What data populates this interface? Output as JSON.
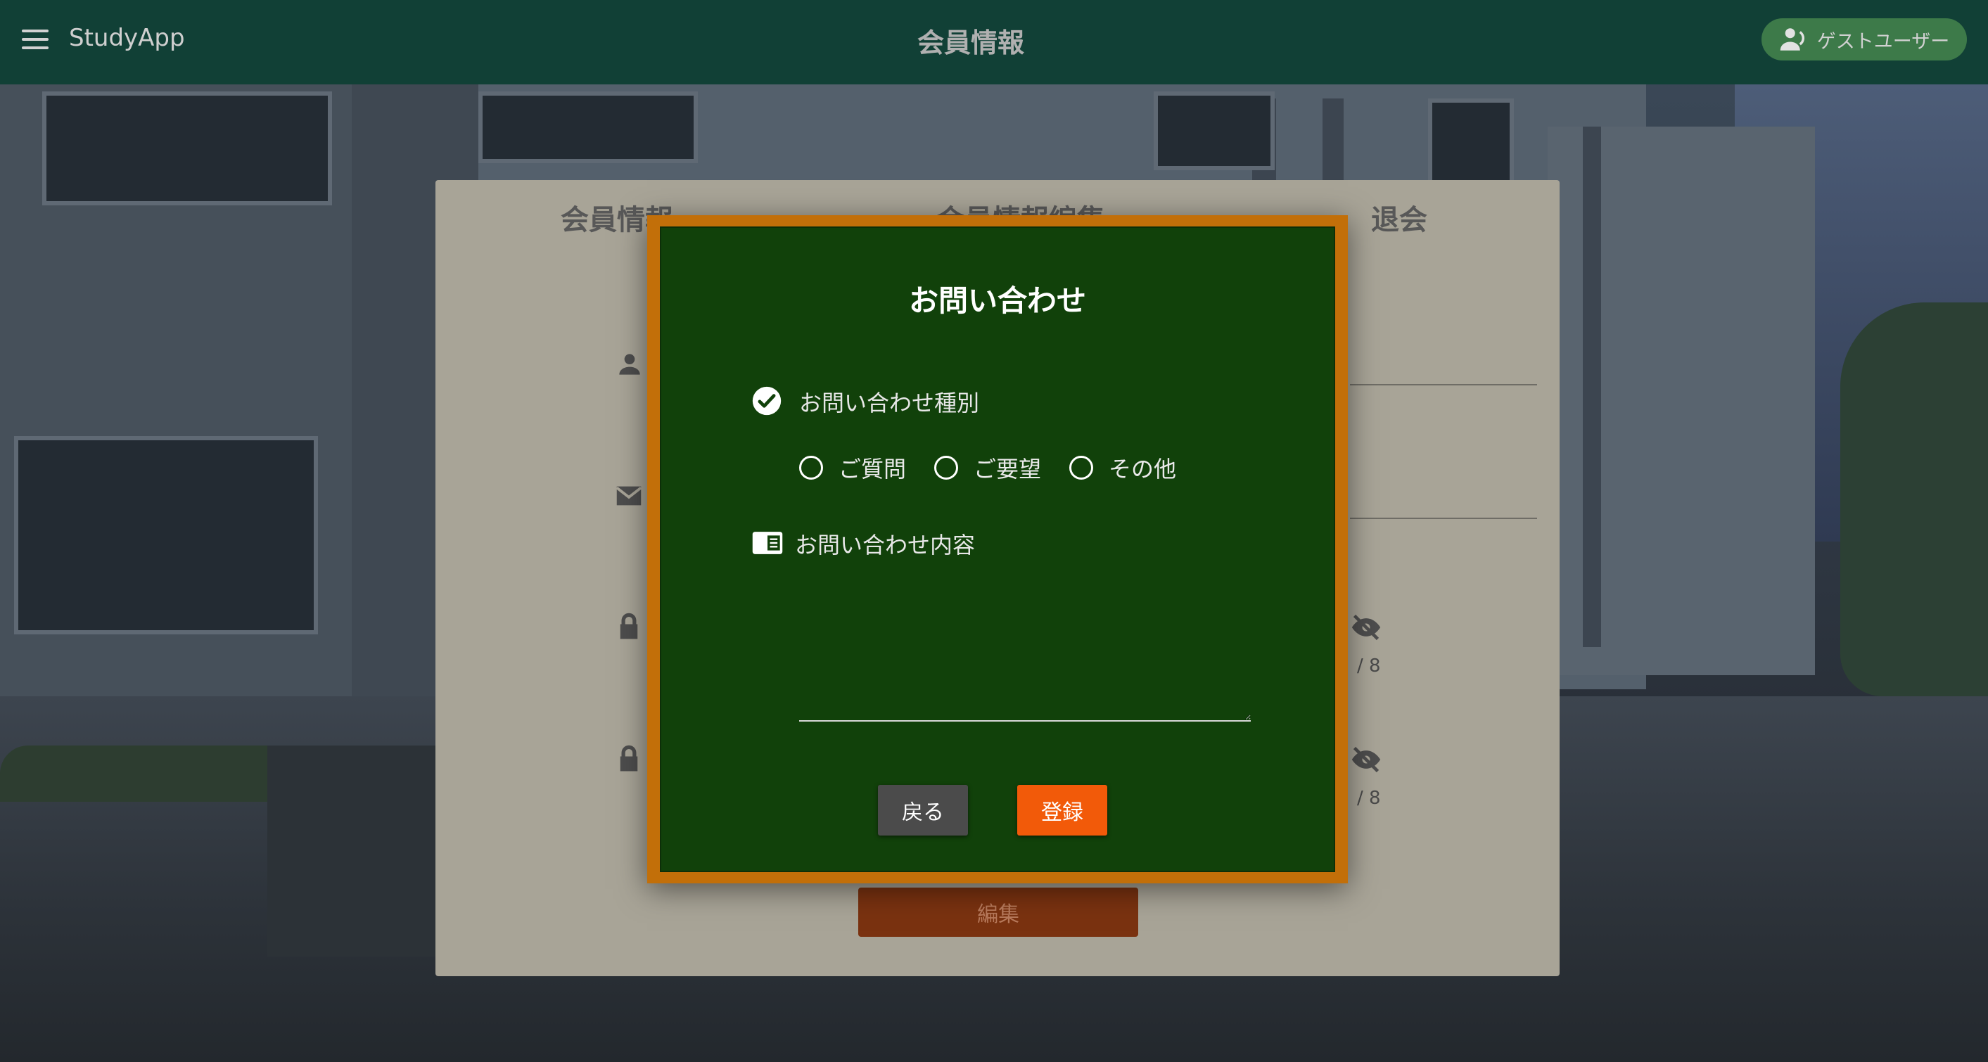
{
  "app": {
    "name": "StudyApp",
    "page_title": "会員情報",
    "guest_label": "ゲストユーザー"
  },
  "card": {
    "tabs": [
      "会員情報",
      "会員情報編集",
      "退会"
    ],
    "password_counter": "/ 8",
    "password_confirm_counter": "/ 8",
    "edit_label": "編集"
  },
  "modal": {
    "title": "お問い合わせ",
    "type_label": "お問い合わせ種別",
    "options": [
      "ご質問",
      "ご要望",
      "その他"
    ],
    "content_label": "お問い合わせ内容",
    "content_value": "",
    "back_label": "戻る",
    "submit_label": "登録"
  },
  "colors": {
    "topbar": "#114036",
    "board": "#11410a",
    "frame": "#c26f09",
    "submit": "#f25a09",
    "back": "#4b4b4b",
    "guest": "#3d7a49"
  }
}
